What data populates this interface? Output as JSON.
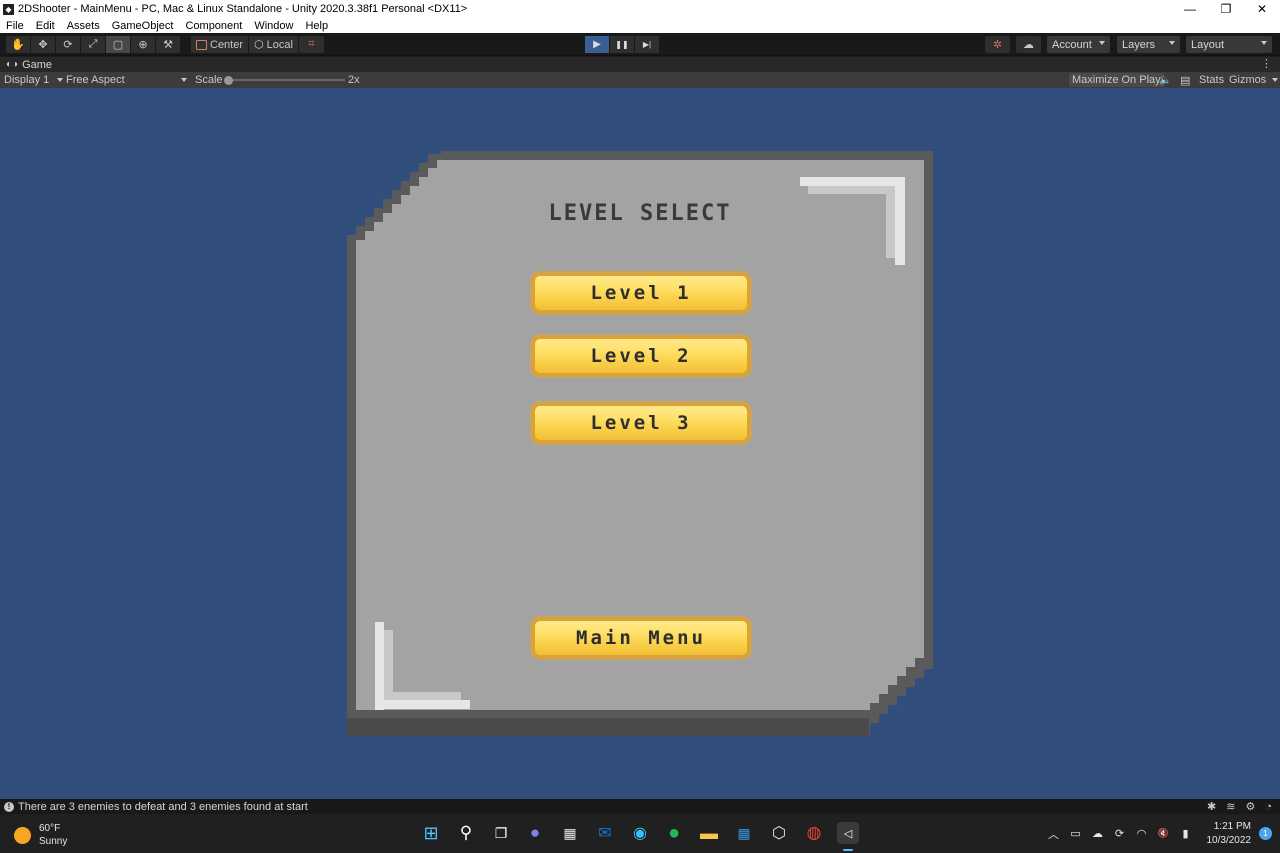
{
  "window": {
    "title": "2DShooter - MainMenu - PC, Mac & Linux Standalone - Unity 2020.3.38f1 Personal <DX11>",
    "minimize_glyph": "—",
    "maximize_glyph": "❐",
    "close_glyph": "✕"
  },
  "menu": [
    "File",
    "Edit",
    "Assets",
    "GameObject",
    "Component",
    "Window",
    "Help"
  ],
  "toolbar": {
    "tools": [
      {
        "name": "hand-tool",
        "glyph": "✋"
      },
      {
        "name": "move-tool",
        "glyph": "✥"
      },
      {
        "name": "rotate-tool",
        "glyph": "⟳"
      },
      {
        "name": "scale-tool",
        "glyph": "⤢"
      },
      {
        "name": "rect-tool",
        "glyph": "▢"
      },
      {
        "name": "transform-tool",
        "glyph": "⊕"
      },
      {
        "name": "custom-tool",
        "glyph": "⚒"
      }
    ],
    "pivot_label": "Center",
    "space_label": "Local",
    "grid_glyph": "⌗",
    "play_glyph": "▶",
    "pause_glyph": "❚❚",
    "step_glyph": "▶|",
    "collab_glyph": "✲",
    "cloud_glyph": "☁",
    "account_label": "Account",
    "layers_label": "Layers",
    "layout_label": "Layout"
  },
  "game_tab": {
    "label": "Game",
    "more_glyph": "⋮"
  },
  "game_toolbar": {
    "display_label": "Display 1",
    "aspect_label": "Free Aspect",
    "scale_label": "Scale",
    "scale_value": "2x",
    "maximize_label": "Maximize On Play",
    "mute_glyph": "🔈",
    "stats_glyph": "▤",
    "stats_label": "Stats",
    "gizmos_label": "Gizmos"
  },
  "game": {
    "title": "LEVEL SELECT",
    "buttons": [
      {
        "label": "Level 1"
      },
      {
        "label": "Level 2"
      },
      {
        "label": "Level 3"
      }
    ],
    "main_menu_label": "Main Menu"
  },
  "status": {
    "message": "There are 3 enemies to defeat and 3 enemies found at start",
    "info_glyph": "!"
  },
  "taskbar": {
    "temperature": "60°F",
    "condition": "Sunny",
    "apps": [
      {
        "name": "start-icon",
        "glyph": "⊞",
        "color": "#4cc2ff"
      },
      {
        "name": "search-icon",
        "glyph": "⚲",
        "color": "#ffffff"
      },
      {
        "name": "task-view-icon",
        "glyph": "❐",
        "color": "#ffffff"
      },
      {
        "name": "chat-icon",
        "glyph": "●",
        "color": "#7b83eb"
      },
      {
        "name": "store-icon",
        "glyph": "▦",
        "color": "#e6e6e6"
      },
      {
        "name": "mail-icon",
        "glyph": "✉",
        "color": "#0f78d4"
      },
      {
        "name": "edge-icon",
        "glyph": "◉",
        "color": "#35c1f1"
      },
      {
        "name": "spotify-icon",
        "glyph": "●",
        "color": "#1db954"
      },
      {
        "name": "explorer-icon",
        "glyph": "▬",
        "color": "#f7c948"
      },
      {
        "name": "calendar-icon",
        "glyph": "▦",
        "color": "#3a96dd"
      },
      {
        "name": "unity-hub-icon",
        "glyph": "⬡",
        "color": "#e6e6e6"
      },
      {
        "name": "chrome-icon",
        "glyph": "◍",
        "color": "#ea4335"
      },
      {
        "name": "unity-editor-icon",
        "glyph": "◁",
        "color": "#ffffff"
      }
    ],
    "tray_glyphs": [
      {
        "name": "tray-chevron-icon",
        "glyph": "︿"
      },
      {
        "name": "tray-display-icon",
        "glyph": "▭"
      },
      {
        "name": "tray-cloud-icon",
        "glyph": "☁"
      },
      {
        "name": "tray-sync-icon",
        "glyph": "⟳"
      },
      {
        "name": "tray-wifi-icon",
        "glyph": "◠"
      },
      {
        "name": "tray-volume-icon",
        "glyph": "🔇"
      },
      {
        "name": "tray-battery-icon",
        "glyph": "▮"
      }
    ],
    "time": "1:21 PM",
    "date": "10/3/2022",
    "notification_count": "1"
  }
}
